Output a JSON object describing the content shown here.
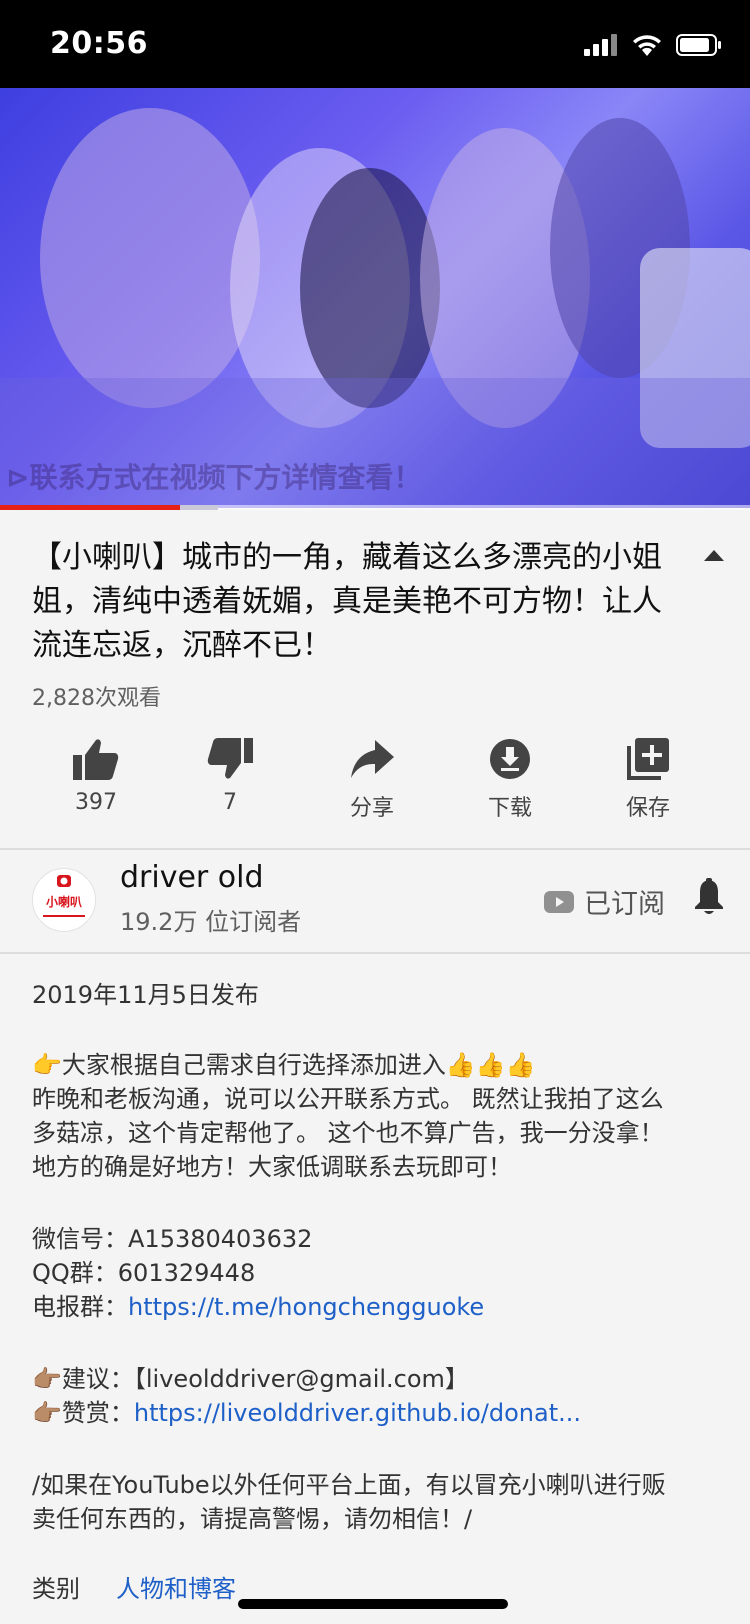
{
  "status": {
    "time": "20:56"
  },
  "video": {
    "overlay_caption": "⊳联系方式在视频下方详情查看！",
    "progress_played": 0.24,
    "progress_buffered": 0.29
  },
  "title": "【小喇叭】城市的一角，藏着这么多漂亮的小姐姐，清纯中透着妩媚，真是美艳不可方物！让人流连忘返，沉醉不已！",
  "views": "2,828次观看",
  "actions": {
    "like_label": "397",
    "dislike_label": "7",
    "share_label": "分享",
    "download_label": "下载",
    "save_label": "保存"
  },
  "channel": {
    "avatar_text": "小喇叭",
    "name": "driver old",
    "subscribers": "19.2万 位订阅者",
    "subscribed_label": "已订阅"
  },
  "description": {
    "date": "2019年11月5日发布",
    "line1": "👉大家根据自己需求自行选择添加进入👍👍👍",
    "line2": "昨晚和老板沟通，说可以公开联系方式。 既然让我拍了这么",
    "line3": "多菇凉，这个肯定帮他了。 这个也不算广告，我一分没拿！",
    "line4": "地方的确是好地方！大家低调联系去玩即可！",
    "wechat_label": "微信号：",
    "wechat_value": "A15380403632",
    "qq_label": "QQ群：",
    "qq_value": "601329448",
    "telegram_label": "电报群：",
    "telegram_link": "https://t.me/hongchengguoke",
    "suggest_label": "👉🏽建议：",
    "suggest_value": "【liveolddriver@gmail.com】",
    "donate_label": "👉🏽赞赏：",
    "donate_link": "https://liveolddriver.github.io/donat...",
    "warning_line1": "/如果在YouTube以外任何平台上面，有以冒充小喇叭进行贩",
    "warning_line2": "卖任何东西的，请提高警惕，请勿相信！/",
    "category_label": "类别",
    "category_value": "人物和博客"
  }
}
